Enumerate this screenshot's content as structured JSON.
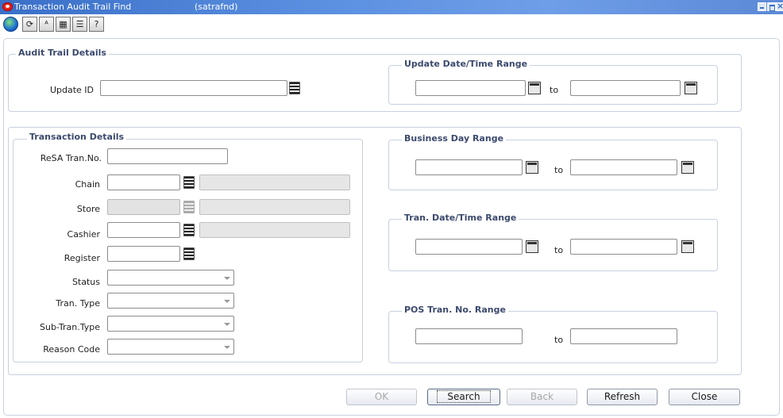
{
  "window": {
    "title": "Transaction Audit Trail Find",
    "code": "(satrafnd)"
  },
  "toolbar": {
    "icons": [
      "globe-icon",
      "history-icon",
      "translate-icon",
      "calendar-icon",
      "notes-icon",
      "help-icon"
    ],
    "glyphs": [
      "",
      "⟳",
      "ᴬ",
      "▦",
      "☰",
      "?"
    ]
  },
  "audit_trail": {
    "title": "Audit Trail Details",
    "update_id_label": "Update ID",
    "update_id_value": ""
  },
  "update_range": {
    "title": "Update Date/Time Range",
    "from": "",
    "to_label": "to",
    "to": ""
  },
  "transaction": {
    "title": "Transaction Details",
    "resa_tran_label": "ReSA Tran.No.",
    "chain_label": "Chain",
    "store_label": "Store",
    "cashier_label": "Cashier",
    "register_label": "Register",
    "status_label": "Status",
    "tran_type_label": "Tran. Type",
    "sub_tran_type_label": "Sub-Tran.Type",
    "reason_code_label": "Reason Code"
  },
  "business_day": {
    "title": "Business Day Range",
    "to_label": "to"
  },
  "tran_datetime": {
    "title": "Tran. Date/Time Range",
    "to_label": "to"
  },
  "pos_tran": {
    "title": "POS Tran. No. Range",
    "to_label": "to"
  },
  "buttons": {
    "ok": "OK",
    "search": "Search",
    "back": "Back",
    "refresh": "Refresh",
    "close": "Close"
  },
  "colors": {
    "titlebar": "#3a6fc8",
    "section_title": "#3c4a6e",
    "close_icon": "#e8201a"
  }
}
